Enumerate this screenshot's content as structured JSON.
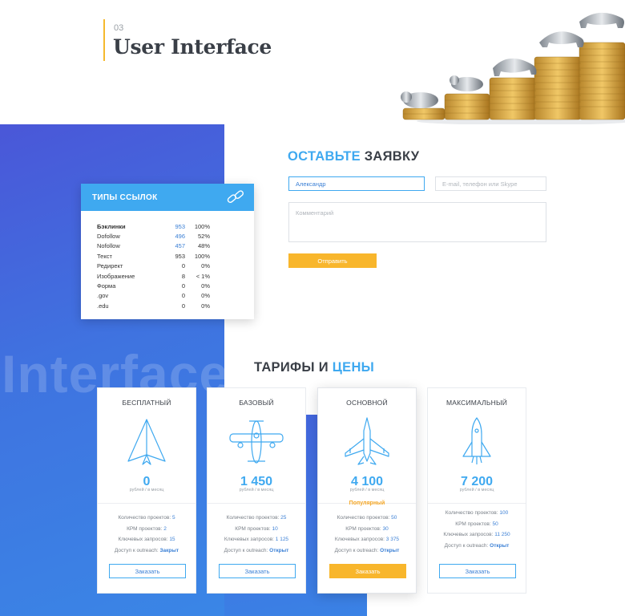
{
  "header": {
    "number": "03",
    "title": "User Interface"
  },
  "background_word": "Interface",
  "link_types": {
    "title": "ТИПЫ ССЫЛОК",
    "rows": [
      {
        "name": "Бэклинки",
        "count": "953",
        "percent": "100%"
      },
      {
        "name": "Dofollow",
        "count": "496",
        "percent": "52%"
      },
      {
        "name": "Nofollow",
        "count": "457",
        "percent": "48%"
      },
      {
        "name": "Текст",
        "count": "953",
        "percent": "100%"
      },
      {
        "name": "Редирект",
        "count": "0",
        "percent": "0%"
      },
      {
        "name": "Изображение",
        "count": "8",
        "percent": "< 1%"
      },
      {
        "name": "Форма",
        "count": "0",
        "percent": "0%"
      },
      {
        "name": ".gov",
        "count": "0",
        "percent": "0%"
      },
      {
        "name": ".edu",
        "count": "0",
        "percent": "0%"
      }
    ]
  },
  "form": {
    "title_accent": "ОСТАВЬТЕ",
    "title_rest": " ЗАЯВКУ",
    "name_value": "Александр",
    "contact_placeholder": "E-mail, телефон или Skype",
    "comment_placeholder": "Комментарий",
    "submit_label": "Отправить"
  },
  "pricing": {
    "title_main": "ТАРИФЫ И ",
    "title_accent": "ЦЕНЫ",
    "plans": [
      {
        "name": "БЕСПЛАТНЫЙ",
        "price": "0",
        "period": "рублей / в месяц",
        "badge": "",
        "projects_label": "Количество проектов:",
        "projects": "5",
        "kpm_label": "КРМ проектов:",
        "kpm": "2",
        "queries_label": "Ключевых запросов:",
        "queries": "15",
        "outreach_label": "Доступ к outreach:",
        "outreach": "Закрыт",
        "button": "Заказать",
        "icon": "paper-plane-icon"
      },
      {
        "name": "БАЗОВЫЙ",
        "price": "1 450",
        "period": "рублей / в месяц",
        "badge": "",
        "projects_label": "Количество проектов:",
        "projects": "25",
        "kpm_label": "КРМ проектов:",
        "kpm": "10",
        "queries_label": "Ключевых запросов:",
        "queries": "1 125",
        "outreach_label": "Доступ к outreach:",
        "outreach": "Открыт",
        "button": "Заказать",
        "icon": "propeller-plane-icon"
      },
      {
        "name": "ОСНОВНОЙ",
        "price": "4 100",
        "period": "рублей / в месяц",
        "badge": "Популярный",
        "projects_label": "Количество проектов:",
        "projects": "50",
        "kpm_label": "КРМ проектов:",
        "kpm": "30",
        "queries_label": "Ключевых запросов:",
        "queries": "3 375",
        "outreach_label": "Доступ к outreach:",
        "outreach": "Открыт",
        "button": "Заказать",
        "icon": "jet-fighter-icon"
      },
      {
        "name": "МАКСИМАЛЬНЫЙ",
        "price": "7 200",
        "period": "рублей / в месяц",
        "badge": "",
        "projects_label": "Количество проектов:",
        "projects": "100",
        "kpm_label": "КРМ проектов:",
        "kpm": "50",
        "queries_label": "Ключевых запросов:",
        "queries": "11 250",
        "outreach_label": "Доступ к outreach:",
        "outreach": "Открыт",
        "button": "Заказать",
        "icon": "space-shuttle-icon"
      }
    ]
  },
  "colors": {
    "accent": "#3fa9f0",
    "button_yellow": "#f8b62c",
    "blue_panel": "#4a57d8",
    "header_bar": "#f5b92e"
  }
}
